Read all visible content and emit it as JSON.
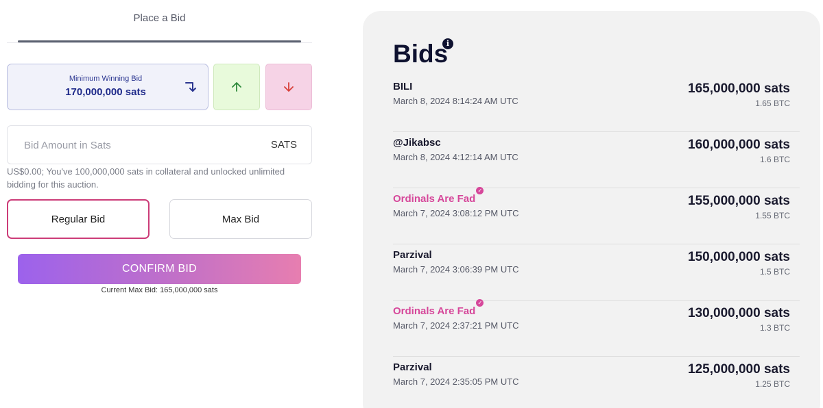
{
  "place_bid": {
    "tab_title": "Place a Bid",
    "min_winning_bid": {
      "label": "Minimum Winning Bid",
      "value": "170,000,000 sats",
      "icon": "arrow-turn-down-icon"
    },
    "increase_icon": "arrow-up-icon",
    "decrease_icon": "arrow-down-icon",
    "bid_input": {
      "placeholder": "Bid Amount in Sats",
      "value": "",
      "unit": "SATS"
    },
    "collateral_note": "US$0.00; You've 100,000,000 sats in collateral and unlocked unlimited bidding for this auction.",
    "bid_types": {
      "regular": "Regular Bid",
      "max": "Max Bid",
      "selected": "regular"
    },
    "confirm_label": "CONFIRM BID",
    "current_max_bid": "Current Max Bid: 165,000,000 sats"
  },
  "bids_panel": {
    "title": "Bids",
    "info_icon": "info-icon",
    "bids": [
      {
        "bidder": "BILI",
        "verified": false,
        "date": "March 8, 2024 8:14:24 AM UTC",
        "sats": "165,000,000 sats",
        "btc": "1.65 BTC"
      },
      {
        "bidder": "@Jikabsc",
        "verified": false,
        "date": "March 8, 2024 4:12:14 AM UTC",
        "sats": "160,000,000 sats",
        "btc": "1.6 BTC"
      },
      {
        "bidder": "Ordinals Are Fad",
        "verified": true,
        "date": "March 7, 2024 3:08:12 PM UTC",
        "sats": "155,000,000 sats",
        "btc": "1.55 BTC"
      },
      {
        "bidder": "Parzival",
        "verified": false,
        "date": "March 7, 2024 3:06:39 PM UTC",
        "sats": "150,000,000 sats",
        "btc": "1.5 BTC"
      },
      {
        "bidder": "Ordinals Are Fad",
        "verified": true,
        "date": "March 7, 2024 2:37:21 PM UTC",
        "sats": "130,000,000 sats",
        "btc": "1.3 BTC"
      },
      {
        "bidder": "Parzival",
        "verified": false,
        "date": "March 7, 2024 2:35:05 PM UTC",
        "sats": "125,000,000 sats",
        "btc": "1.25 BTC"
      }
    ]
  },
  "colors": {
    "accent_pink": "#d6479a",
    "selected_border": "#cc3c78",
    "navy": "#1f2a8a",
    "increase_bg": "#e8fadb",
    "decrease_bg": "#f6d3e6"
  }
}
